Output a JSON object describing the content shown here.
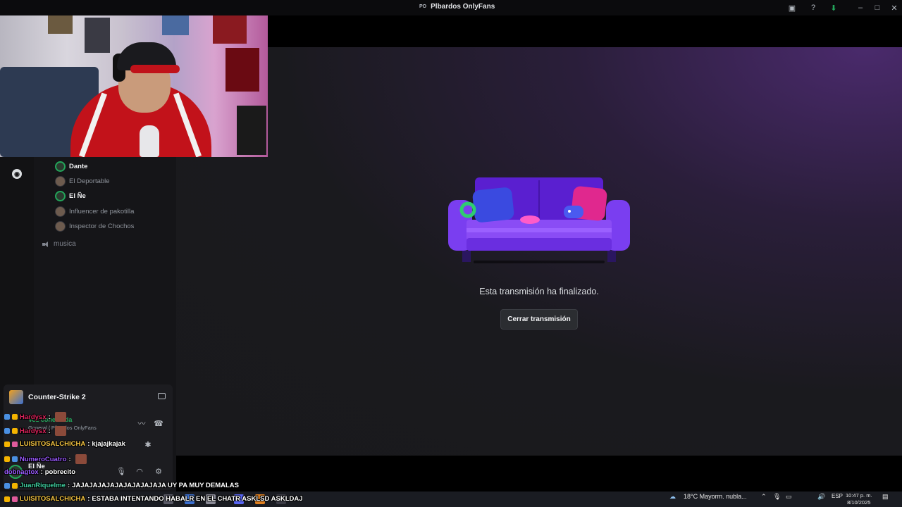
{
  "window": {
    "server_badge": "PO",
    "title": "Plbardos OnlyFans"
  },
  "voice_users": [
    {
      "name": "Dante",
      "speaking": true
    },
    {
      "name": "El Deportable",
      "speaking": false
    },
    {
      "name": "El Ñe",
      "speaking": true
    },
    {
      "name": "Influencer de pakotilla",
      "speaking": false
    },
    {
      "name": "Inspector de Chochos",
      "speaking": false
    }
  ],
  "channel": {
    "name": "musica"
  },
  "stage": {
    "end_message": "Esta transmisión ha finalizado.",
    "close_button": "Cerrar transmisión"
  },
  "activity": {
    "game": "Counter-Strike 2",
    "voice_status": "Voz conectada",
    "voice_location": "General / Plbardos OnlyFans",
    "self_name": "El Ñe"
  },
  "chat": [
    {
      "user": "Hardysx",
      "color": "#e0245e",
      "text": "",
      "emote": true
    },
    {
      "user": "Hardysx",
      "color": "#e0245e",
      "text": "",
      "emote": true
    },
    {
      "user": "LUISITOSALCHICHA",
      "color": "#f5c542",
      "text": "kjajajkajak",
      "emote": false
    },
    {
      "user": "NumeroCuatro",
      "color": "#9b59ff",
      "text": "",
      "emote": true
    },
    {
      "user": "dobnagtox",
      "color": "#9b59ff",
      "text": "pobrecito",
      "emote": false
    },
    {
      "user": "JuanRiquelme",
      "color": "#3fd0a0",
      "text": "JAJAJAJAJAJAJAJAJAJAJA UY PA MUY DEMALAS",
      "emote": false
    },
    {
      "user": "LUISITOSALCHICHA",
      "color": "#f5c542",
      "text": "ESTABA INTENTANDO HABALR EN EL CHATR ASKLSD ASKLDAJ",
      "emote": false
    }
  ],
  "taskbar": {
    "weather": "18°C  Mayorm. nubla...",
    "lang": "ESP",
    "time": "10:47 p. m.",
    "date": "8/10/2025"
  }
}
